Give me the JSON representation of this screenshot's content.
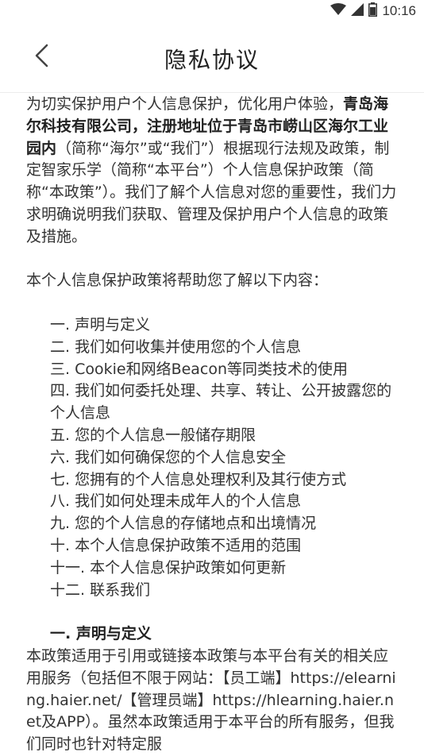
{
  "status_bar": {
    "time": "10:16",
    "icons": [
      "wifi-icon",
      "cell-signal-icon",
      "battery-icon"
    ]
  },
  "nav": {
    "back_icon": "chevron-left-icon",
    "title": "隐私协议"
  },
  "intro": {
    "part1": "为切实保护用户个人信息保护，优化用户体验，",
    "bold": "青岛海尔科技有限公司，注册地址位于青岛市崂山区海尔工业园内",
    "part2": "（简称“海尔”或“我们”）根据现行法规及政策，制定智家乐学（简称“本平台”）个人信息保护政策（简称“本政策”）。我们了解个人信息对您的重要性，我们力求明确说明我们获取、管理及保护用户个人信息的政策及措施。"
  },
  "summary_line": "本个人信息保护政策将帮助您了解以下内容：",
  "toc": [
    "一. 声明与定义",
    "二. 我们如何收集并使用您的个人信息",
    "三. Cookie和网络Beacon等同类技术的使用",
    "四. 我们如何委托处理、共享、转让、公开披露您的个人信息",
    "五. 您的个人信息一般储存期限",
    "六. 我们如何确保您的个人信息安全",
    "七. 您拥有的个人信息处理权利及其行使方式",
    "八. 我们如何处理未成年人的个人信息",
    "九. 您的个人信息的存储地点和出境情况",
    "十. 本个人信息保护政策不适用的范围",
    "十一. 本个人信息保护政策如何更新",
    "十二. 联系我们"
  ],
  "section1": {
    "heading": "一. 声明与定义",
    "body": "本政策适用于引用或链接本政策与本平台有关的相关应用服务（包括但不限于网站：【员工端】https://elearning.haier.net/【管理员端】https://hlearning.haier.net及APP）。虽然本政策适用于本平台的所有服务，但我们同时也针对特定服"
  }
}
